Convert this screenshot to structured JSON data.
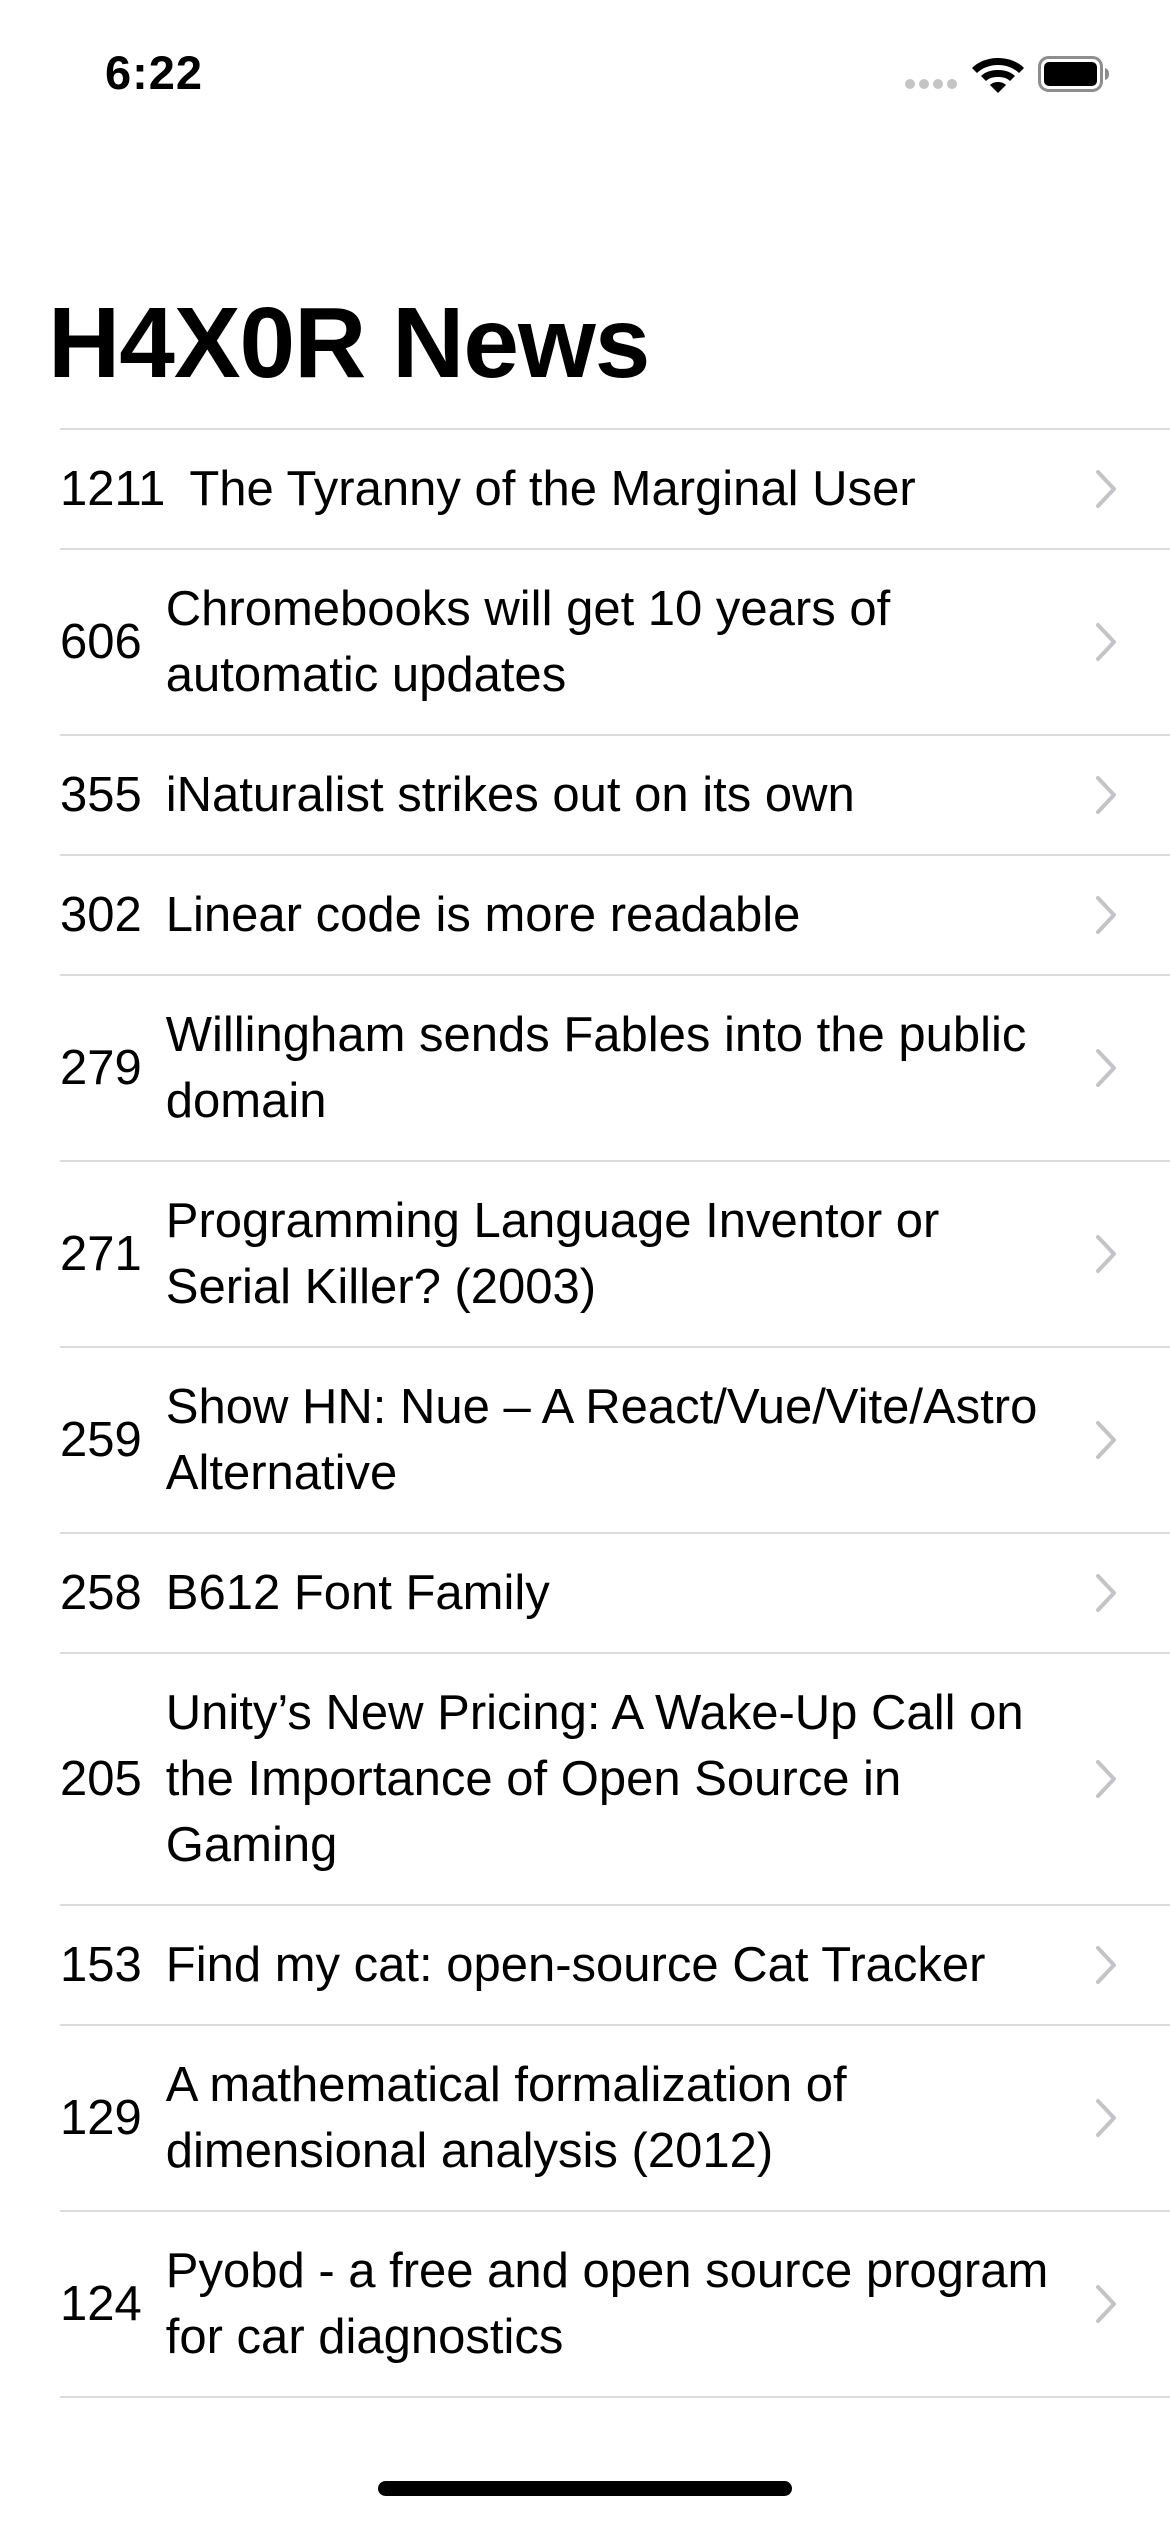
{
  "status_bar": {
    "time": "6:22"
  },
  "nav": {
    "title": "H4X0R News"
  },
  "stories": [
    {
      "points": "1211",
      "title": "The Tyranny of the Marginal User"
    },
    {
      "points": "606",
      "title": "Chromebooks will get 10 years of automatic updates"
    },
    {
      "points": "355",
      "title": "iNaturalist strikes out on its own"
    },
    {
      "points": "302",
      "title": "Linear code is more readable"
    },
    {
      "points": "279",
      "title": "Willingham sends Fables into the public domain"
    },
    {
      "points": "271",
      "title": "Programming Language Inventor or Serial Killer? (2003)"
    },
    {
      "points": "259",
      "title": "Show HN: Nue – A React/Vue/Vite/Astro Alternative"
    },
    {
      "points": "258",
      "title": "B612 Font Family"
    },
    {
      "points": "205",
      "title": "Unity’s New Pricing: A Wake-Up Call on the Importance of Open Source in Gaming"
    },
    {
      "points": "153",
      "title": "Find my cat: open-source Cat Tracker"
    },
    {
      "points": "129",
      "title": "A mathematical formalization of dimensional analysis (2012)"
    },
    {
      "points": "124",
      "title": "Pyobd - a free and open source program for car diagnostics"
    }
  ],
  "icons": {
    "row_accessory": "chevron-right-icon",
    "wifi": "wifi-icon",
    "battery": "battery-icon",
    "signal": "signal-dots-icon"
  },
  "colors": {
    "separator": "#dcdcdc",
    "chevron": "#c4c4c8",
    "text": "#000000",
    "background": "#ffffff"
  }
}
